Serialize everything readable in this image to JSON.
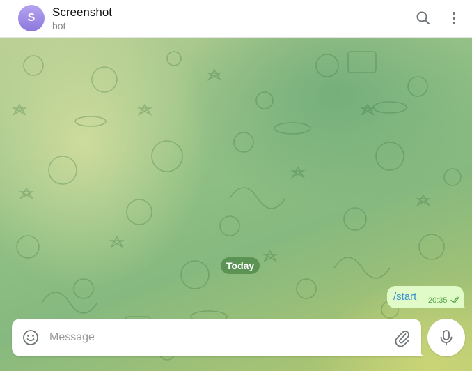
{
  "header": {
    "avatar_letter": "S",
    "title": "Screenshot",
    "subtitle": "bot",
    "icons": {
      "search": "search-icon",
      "more": "more-vertical-icon"
    }
  },
  "chat": {
    "date_label": "Today",
    "messages": [
      {
        "text": "/start",
        "time": "20:35",
        "status": "read-double-check",
        "outgoing": true
      }
    ]
  },
  "composer": {
    "placeholder": "Message",
    "value": "",
    "icons": {
      "emoji": "emoji-icon",
      "attach": "paperclip-icon",
      "mic": "microphone-icon"
    }
  },
  "colors": {
    "accent": "#3a8fd0",
    "bubble_out": "#e0fbc8",
    "time_green": "#56a34a",
    "avatar_top": "#b6a4f0",
    "avatar_bottom": "#8c78dc"
  }
}
